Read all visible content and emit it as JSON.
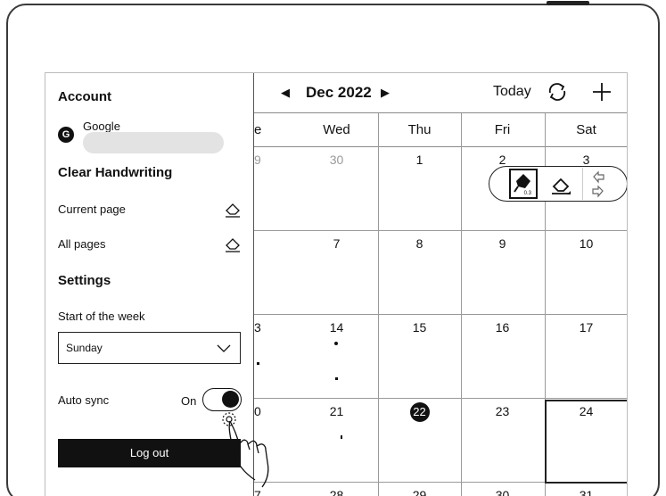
{
  "calendar": {
    "month": "Dec 2022",
    "today_label": "Today",
    "weekdays": [
      "e",
      "Wed",
      "Thu",
      "Fri",
      "Sat"
    ],
    "rows": [
      [
        "9",
        "30",
        "1",
        "2",
        "3"
      ],
      [
        "",
        "7",
        "8",
        "9",
        "10"
      ],
      [
        "3",
        "14",
        "15",
        "16",
        "17"
      ],
      [
        "0",
        "21",
        "22",
        "23",
        "24"
      ],
      [
        "7",
        "28",
        "29",
        "30",
        "31"
      ]
    ],
    "today_date": "22",
    "selected_date": "24",
    "pen_size": "0.3"
  },
  "panel": {
    "account_heading": "Account",
    "account_provider": "Google",
    "google_logo": "G",
    "clear_heading": "Clear Handwriting",
    "current_page": "Current page",
    "all_pages": "All pages",
    "settings_heading": "Settings",
    "start_week_label": "Start of the week",
    "start_week_value": "Sunday",
    "auto_sync_label": "Auto sync",
    "auto_sync_state": "On",
    "logout_label": "Log out"
  },
  "icons": {
    "prev": "chevron-left-icon",
    "next": "chevron-right-icon",
    "sync": "sync-icon",
    "add": "plus-icon",
    "eraser": "eraser-icon",
    "dropdown": "chevron-down-icon",
    "pen": "pen-icon",
    "undo": "undo-icon",
    "redo": "redo-icon",
    "hand": "hand-pointer-icon"
  }
}
